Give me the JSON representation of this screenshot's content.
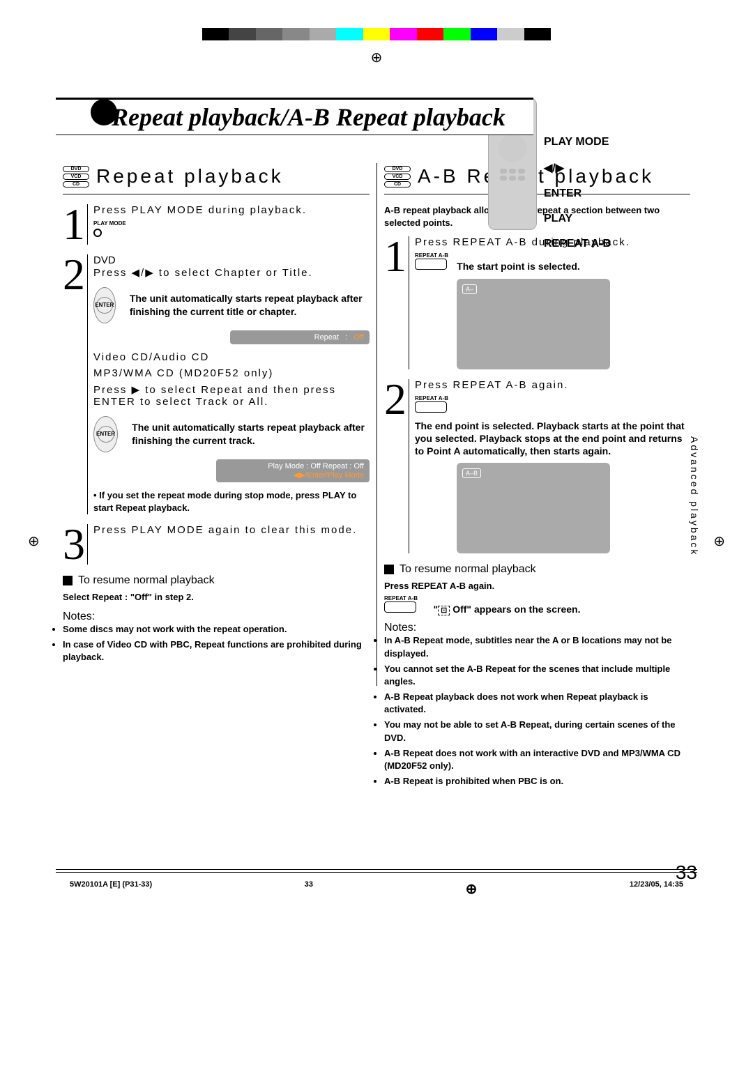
{
  "page": {
    "title": "Repeat playback/A-B Repeat playback",
    "number": "33",
    "side_tab": "Advanced playback"
  },
  "remote_labels": {
    "l1": "PLAY MODE",
    "l2": "◀/▶",
    "l3": "ENTER",
    "l4": "PLAY",
    "l5": "REPEAT A-B"
  },
  "disc": {
    "dvd": "DVD",
    "vcd": "VCD",
    "cd": "CD"
  },
  "left": {
    "heading": "Repeat playback",
    "step1": {
      "instr": "Press PLAY MODE during playback.",
      "label": "PLAY MODE"
    },
    "step2": {
      "line1": "DVD",
      "line2": "Press ◀/▶ to select Chapter or Title.",
      "bold": "The unit automatically starts repeat playback after finishing the current title or chapter.",
      "osd": {
        "repeat": "Repeat",
        "val": "Off"
      },
      "line3": "Video CD/Audio CD",
      "line4": "MP3/WMA CD (MD20F52 only)",
      "line5": "Press ▶ to select Repeat and then press ENTER to select Track or All.",
      "bold2": "The unit automatically starts repeat playback after finishing the current track.",
      "osd2": {
        "text": "Play Mode : Off   Repeat : Off",
        "hint": "◀▶/Enter/Play Mode"
      },
      "note1": "• If you set the repeat mode during stop mode, press PLAY to start Repeat playback."
    },
    "step3": {
      "instr": "Press PLAY MODE again to clear this mode."
    },
    "resume_head": "To resume normal playback",
    "resume_body": "Select Repeat : \"Off\" in step 2.",
    "notes_head": "Notes:",
    "notes": [
      "Some discs may not work with the repeat operation.",
      "In case of Video CD with PBC, Repeat functions are prohibited during playback."
    ]
  },
  "right": {
    "heading": "A-B Repeat playback",
    "intro": "A-B repeat playback allows you to repeat a section between two selected points.",
    "step1": {
      "instr": "Press REPEAT A-B during playback.",
      "label": "REPEAT A-B",
      "bold": "The start point is selected.",
      "osd_a": "A–"
    },
    "step2": {
      "instr": "Press REPEAT A-B again.",
      "label": "REPEAT A-B",
      "bold": "The end point is selected. Playback starts at the point that you selected. Playback stops at the end point and returns to Point A automatically, then starts again.",
      "osd_ab": "A–B"
    },
    "resume_head": "To resume normal playback",
    "resume_body": "Press REPEAT A-B again.",
    "resume_label": "REPEAT A-B",
    "off_text": "\" Off \" appears on the screen.",
    "off_icon_label": "Off",
    "notes_head": "Notes:",
    "notes": [
      "In A-B Repeat mode, subtitles near the A or B locations may not be displayed.",
      "You cannot set the A-B Repeat for the scenes that include multiple angles.",
      "A-B Repeat playback does not work when Repeat playback is activated.",
      "You may not be able to set A-B Repeat, during certain scenes of the DVD.",
      "A-B Repeat does not work with an interactive DVD and MP3/WMA CD (MD20F52 only).",
      "A-B Repeat is prohibited when PBC is on."
    ]
  },
  "footer": {
    "left": "5W20101A [E] (P31-33)",
    "mid": "33",
    "right": "12/23/05, 14:35"
  }
}
